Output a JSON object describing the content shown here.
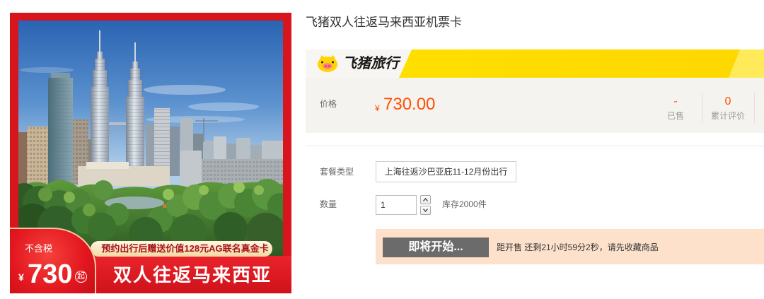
{
  "product_image": {
    "badge": {
      "note": "不含税",
      "currency": "¥",
      "price": "730",
      "suffix": "起"
    },
    "promo": "预约出行后赠送价值128元AG联名真金卡",
    "headline": "双人往返马来西亚",
    "frame_color": "#d7151d"
  },
  "title": "飞猪双人往返马来西亚机票卡",
  "brand": {
    "logo_text": "飞猪旅行",
    "icon": "pig-icon",
    "accent": "#ffe100"
  },
  "price": {
    "label": "价格",
    "currency": "¥",
    "value": "730.00",
    "color": "#ff5000"
  },
  "stats": [
    {
      "value": "-",
      "label": "已售"
    },
    {
      "value": "0",
      "label": "累计评价"
    }
  ],
  "sku": {
    "label": "套餐类型",
    "options": [
      "上海往返沙巴亚庇11-12月份出行"
    ]
  },
  "quantity": {
    "label": "数量",
    "value": "1",
    "stock": "库存2000件",
    "icons": [
      "chevron-up-icon",
      "chevron-down-icon"
    ]
  },
  "sale": {
    "button_label": "即将开始...",
    "countdown": "距开售 还剩21小时59分2秒，请先收藏商品",
    "panel_color": "#fde1cb",
    "button_color": "#6b6b6b"
  }
}
